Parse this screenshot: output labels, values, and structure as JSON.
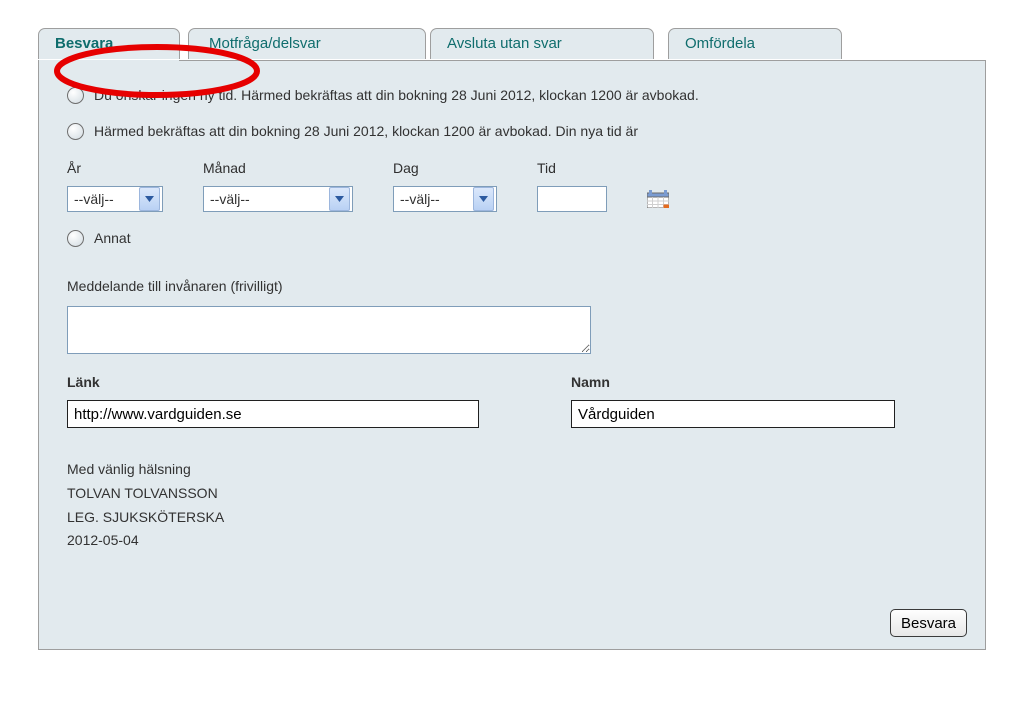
{
  "tabs": {
    "besvara": "Besvara",
    "motfraga": "Motfråga/delsvar",
    "avsluta": "Avsluta utan svar",
    "omfordela": "Omfördela"
  },
  "options": {
    "opt1": "Du önskar ingen ny tid. Härmed bekräftas att din bokning 28 Juni 2012, klockan 1200 är avbokad.",
    "opt2": "Härmed bekräftas att din bokning 28 Juni 2012, klockan 1200 är avbokad. Din nya tid är",
    "opt3": "Annat"
  },
  "date": {
    "year_label": "År",
    "month_label": "Månad",
    "day_label": "Dag",
    "time_label": "Tid",
    "year_value": "--välj--",
    "month_value": "--välj--",
    "day_value": "--välj--",
    "time_value": ""
  },
  "message": {
    "label": "Meddelande till invånaren (frivilligt)",
    "value": ""
  },
  "link": {
    "label": "Länk",
    "value": "http://www.vardguiden.se"
  },
  "name": {
    "label": "Namn",
    "value": "Vårdguiden"
  },
  "signature": {
    "greeting": "Med vänlig hälsning",
    "person": "TOLVAN TOLVANSSON",
    "title": "LEG. SJUKSKÖTERSKA",
    "date": "2012-05-04"
  },
  "submit_label": "Besvara"
}
